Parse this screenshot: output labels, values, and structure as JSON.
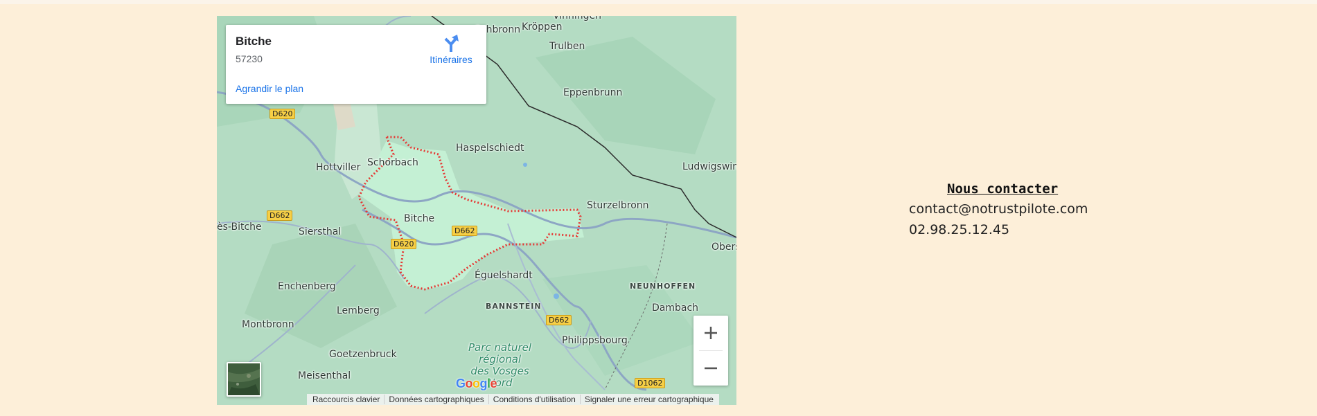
{
  "map": {
    "info_card": {
      "title": "Bitche",
      "postcode": "57230",
      "directions_label": "Itinéraires",
      "enlarge_link": "Agrandir le plan"
    },
    "places": [
      "Vinningen",
      "Schbronn",
      "Kröppen",
      "Trulben",
      "Eppenbrunn",
      "Haspelschiedt",
      "Schorbach",
      "Hottviller",
      "Ludwigswin",
      "Sturzelbronn",
      "Bitche",
      "ès-Bitche",
      "Siersthal",
      "Obers",
      "Éguelshardt",
      "Enchenberg",
      "Lemberg",
      "Montbronn",
      "Dambach",
      "Philippsbourg",
      "Goetzenbruck",
      "Meisenthal"
    ],
    "regions": [
      "NEUNHOFFEN",
      "BANNSTEIN"
    ],
    "park": [
      "Parc naturel",
      "régional",
      "des Vosges",
      "Nord"
    ],
    "roads": [
      "D620",
      "D662",
      "D662",
      "D620",
      "D662",
      "D1062"
    ],
    "logo": [
      "G",
      "o",
      "o",
      "g",
      "l",
      "e"
    ],
    "zoom_in_icon": "plus-icon",
    "zoom_out_icon": "minus-icon",
    "layer_icon": "satellite-thumbnail",
    "attribution": [
      "Raccourcis clavier",
      "Données cartographiques",
      "Conditions d'utilisation",
      "Signaler une erreur cartographique"
    ],
    "colors": {
      "land": "#b7dec6",
      "highlight": "#c4f0d4",
      "boundary": "#e53935",
      "border": "#2b2b2b",
      "road": "#8da6c4",
      "link": "#1a73e8"
    }
  },
  "contact": {
    "title": "Nous contacter",
    "email": "contact@notrustpilote.com",
    "phone": "02.98.25.12.45"
  },
  "page": {
    "background": "#fdefd9"
  }
}
